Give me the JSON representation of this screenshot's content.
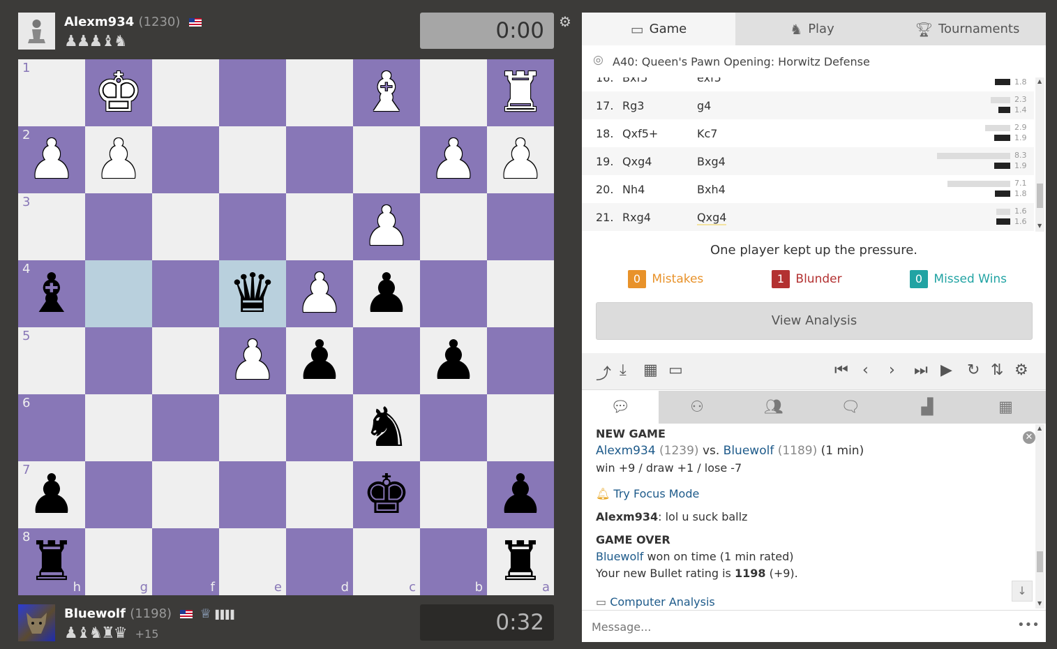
{
  "top_player": {
    "name": "Alexm934",
    "rating": "(1230)",
    "captured": "♟♟♟♝♞",
    "clock": "0:00"
  },
  "bottom_player": {
    "name": "Bluewolf",
    "rating": "(1198)",
    "captured": "♟♝♞♜♛",
    "advantage": "+15",
    "clock": "0:32",
    "badge": "♕",
    "bars": "▌▌▌▌"
  },
  "board": {
    "ranks": [
      "1",
      "2",
      "3",
      "4",
      "5",
      "6",
      "7",
      "8"
    ],
    "files": [
      "h",
      "g",
      "f",
      "e",
      "d",
      "c",
      "b",
      "a"
    ],
    "highlighted": [
      "g4",
      "e4"
    ],
    "pieces": [
      {
        "sq": "g1",
        "p": "♚",
        "c": "w"
      },
      {
        "sq": "c1",
        "p": "♝",
        "c": "w"
      },
      {
        "sq": "a1",
        "p": "♜",
        "c": "w"
      },
      {
        "sq": "h2",
        "p": "♟",
        "c": "w"
      },
      {
        "sq": "g2",
        "p": "♟",
        "c": "w"
      },
      {
        "sq": "b2",
        "p": "♟",
        "c": "w"
      },
      {
        "sq": "a2",
        "p": "♟",
        "c": "w"
      },
      {
        "sq": "c3",
        "p": "♟",
        "c": "w"
      },
      {
        "sq": "h4",
        "p": "♝",
        "c": "b"
      },
      {
        "sq": "e4",
        "p": "♛",
        "c": "b"
      },
      {
        "sq": "d4",
        "p": "♟",
        "c": "w"
      },
      {
        "sq": "c4",
        "p": "♟",
        "c": "b"
      },
      {
        "sq": "e5",
        "p": "♟",
        "c": "w"
      },
      {
        "sq": "d5",
        "p": "♟",
        "c": "b"
      },
      {
        "sq": "b5",
        "p": "♟",
        "c": "b"
      },
      {
        "sq": "c6",
        "p": "♞",
        "c": "b"
      },
      {
        "sq": "h7",
        "p": "♟",
        "c": "b"
      },
      {
        "sq": "c7",
        "p": "♚",
        "c": "b"
      },
      {
        "sq": "a7",
        "p": "♟",
        "c": "b"
      },
      {
        "sq": "h8",
        "p": "♜",
        "c": "b"
      },
      {
        "sq": "a8",
        "p": "♜",
        "c": "b"
      }
    ]
  },
  "tabs": [
    {
      "label": "Game",
      "icon": "game-icon"
    },
    {
      "label": "Play",
      "icon": "play-icon"
    },
    {
      "label": "Tournaments",
      "icon": "trophy-icon"
    }
  ],
  "opening": "A40: Queen's Pawn Opening: Horwitz Defense",
  "moves": [
    {
      "num": "16.",
      "w": "Bxf5",
      "b": "exf5",
      "tw": null,
      "tb": "1.8",
      "ww": 0,
      "wb": 22
    },
    {
      "num": "17.",
      "w": "Rg3",
      "b": "g4",
      "tw": "2.3",
      "tb": "1.4",
      "ww": 28,
      "wb": 17
    },
    {
      "num": "18.",
      "w": "Qxf5+",
      "b": "Kc7",
      "tw": "2.9",
      "tb": "1.9",
      "ww": 36,
      "wb": 23
    },
    {
      "num": "19.",
      "w": "Qxg4",
      "b": "Bxg4",
      "tw": "8.3",
      "tb": "1.9",
      "ww": 105,
      "wb": 23
    },
    {
      "num": "20.",
      "w": "Nh4",
      "b": "Bxh4",
      "tw": "7.1",
      "tb": "1.8",
      "ww": 90,
      "wb": 22
    },
    {
      "num": "21.",
      "w": "Rxg4",
      "b": "Qxg4",
      "tw": "1.6",
      "tb": "1.6",
      "ww": 20,
      "wb": 20
    }
  ],
  "summary": "One player kept up the pressure.",
  "stats": {
    "mistakes": {
      "count": "0",
      "label": "Mistakes",
      "color": "#e8922a"
    },
    "blunder": {
      "count": "1",
      "label": "Blunder",
      "color": "#b33131"
    },
    "missed": {
      "count": "0",
      "label": "Missed Wins",
      "color": "#21a3a3"
    }
  },
  "view_analysis": "View Analysis",
  "chat": {
    "new_game": "NEW GAME",
    "p1": "Alexm934",
    "p1_rating": "(1239)",
    "vs": "vs.",
    "p2": "Bluewolf",
    "p2_rating": "(1189)",
    "mode": "(1 min)",
    "stakes": "win +9 / draw +1 / lose -7",
    "focus": "Try Focus Mode",
    "author": "Alexm934",
    "message": ": lol u suck ballz",
    "game_over": "GAME OVER",
    "winner": "Bluewolf",
    "result": "won on time (1 min rated)",
    "rating_prefix": "Your new Bullet rating is",
    "new_rating": "1198",
    "rating_delta": "(+9).",
    "computer_analysis": "Computer Analysis"
  },
  "message_placeholder": "Message..."
}
